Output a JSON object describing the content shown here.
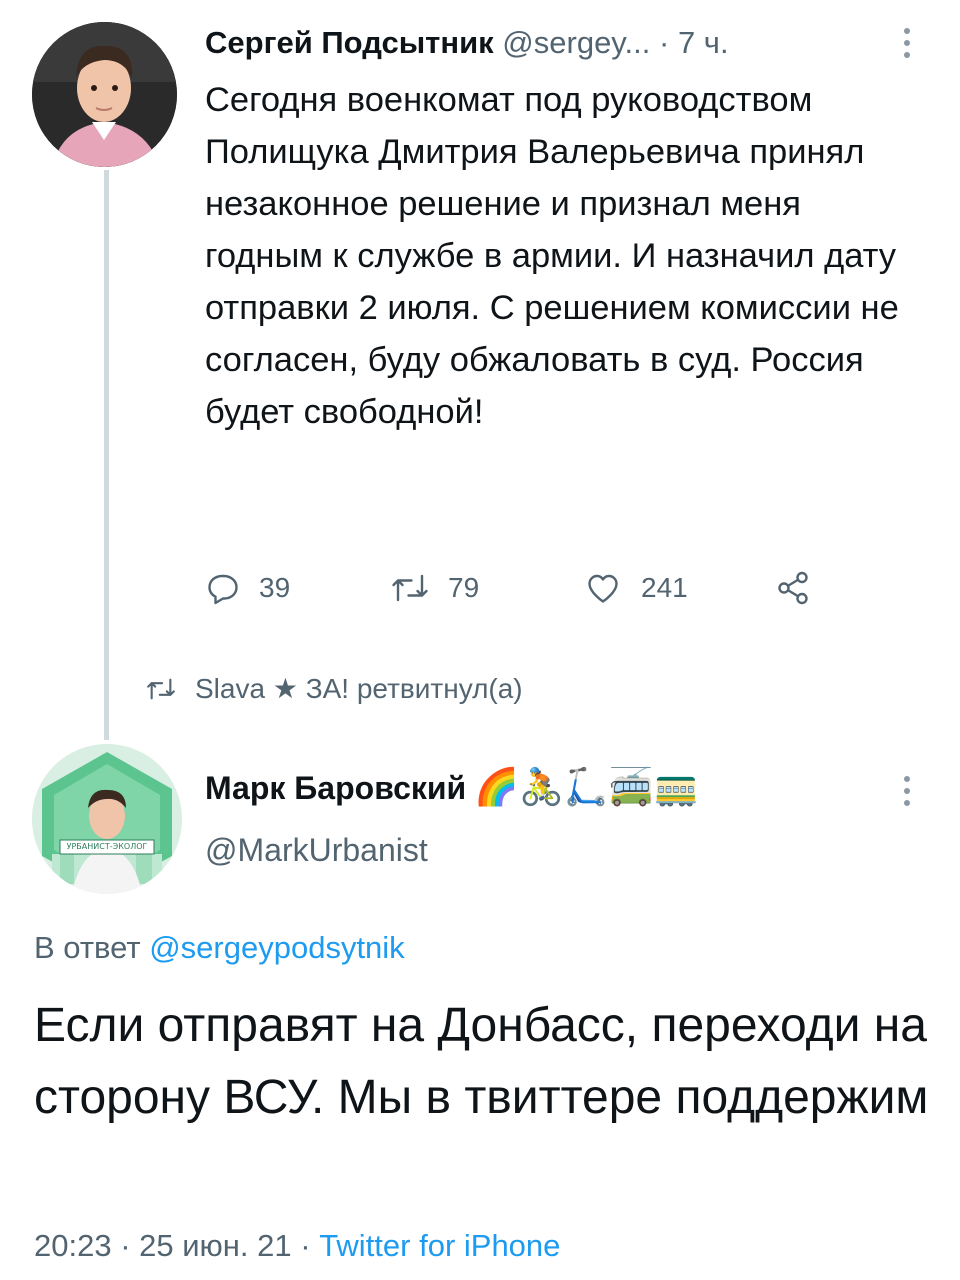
{
  "tweet1": {
    "author_name": "Сергей Подсытник",
    "author_handle": "@sergey...",
    "time_sep": "·",
    "time": "7 ч.",
    "text": "Сегодня военкомат под руководством Полищука Дмитрия Валерьевича принял незаконное решение и признал меня годным к службе в армии. И назначил дату отправки 2 июля. С решением комиссии не согласен, буду обжаловать в суд. Россия будет свободной!",
    "replies": "39",
    "retweets": "79",
    "likes": "241"
  },
  "retweet_note": "Slava ★ ЗА! ретвитнул(а)",
  "tweet2": {
    "author_name": "Марк Баровский",
    "author_emojis": "🌈🚴🛴🚎🚃",
    "author_handle": "@MarkUrbanist",
    "avatar_badge": "УРБАНИСТ-ЭКОЛОГ",
    "reply_prefix": "В ответ",
    "reply_to": "@sergeypodsytnik",
    "text": "Если отправят на Донбасс, переходи на сторону ВСУ. Мы в твиттере поддержим",
    "timestamp": "20:23 · 25 июн. 21 ·",
    "source": "Twitter for iPhone"
  },
  "colors": {
    "text": "#0f1419",
    "secondary": "#536471",
    "accent": "#1d9bf0",
    "thread_line": "#cfd9de"
  },
  "icons": [
    "reply-icon",
    "retweet-icon",
    "like-icon",
    "share-icon",
    "more-icon"
  ]
}
